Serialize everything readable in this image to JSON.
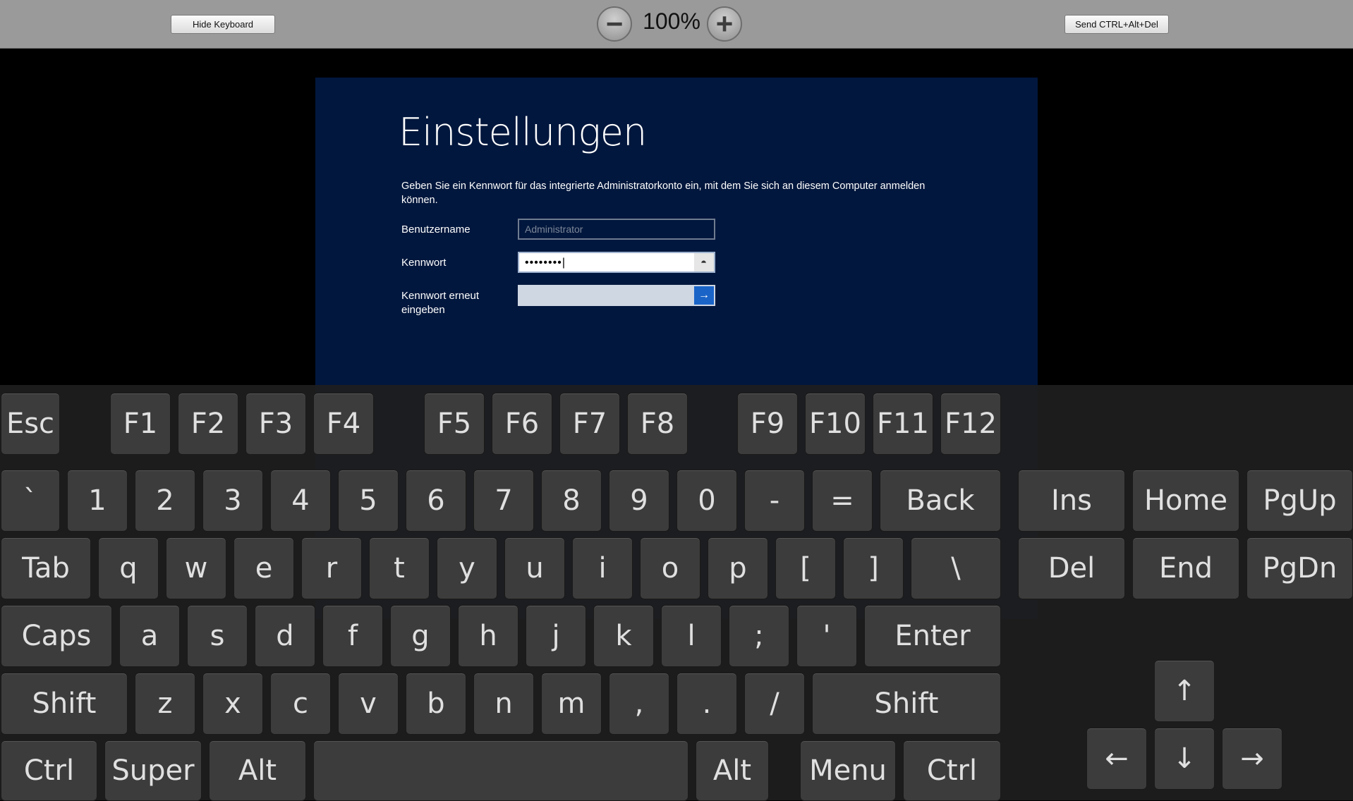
{
  "toolbar": {
    "hide_keyboard": "Hide Keyboard",
    "zoom": "100%",
    "zoom_out": "−",
    "zoom_in": "+",
    "send_cad": "Send CTRL+Alt+Del"
  },
  "remote": {
    "title": "Einstellungen",
    "description": "Geben Sie ein Kennwort für das integrierte Administratorkonto ein, mit dem Sie sich an diesem Computer anmelden können.",
    "username_label": "Benutzername",
    "username_placeholder": "Administrator",
    "password_label": "Kennwort",
    "password_value": "••••••••|",
    "password_confirm_label": "Kennwort erneut eingeben",
    "reveal_glyph": "◓",
    "go_glyph": "→"
  },
  "keyboard": {
    "fn": [
      "Esc",
      "F1",
      "F2",
      "F3",
      "F4",
      "F5",
      "F6",
      "F7",
      "F8",
      "F9",
      "F10",
      "F11",
      "F12"
    ],
    "row1": [
      "`",
      "1",
      "2",
      "3",
      "4",
      "5",
      "6",
      "7",
      "8",
      "9",
      "0",
      "-",
      "=",
      "Back"
    ],
    "row2": [
      "Tab",
      "q",
      "w",
      "e",
      "r",
      "t",
      "y",
      "u",
      "i",
      "o",
      "p",
      "[",
      "]",
      "\\"
    ],
    "row3": [
      "Caps",
      "a",
      "s",
      "d",
      "f",
      "g",
      "h",
      "j",
      "k",
      "l",
      ";",
      "'",
      "Enter"
    ],
    "row4": [
      "Shift",
      "z",
      "x",
      "c",
      "v",
      "b",
      "n",
      "m",
      ",",
      ".",
      "/",
      "Shift"
    ],
    "row5": [
      "Ctrl",
      "Super",
      "Alt",
      " ",
      "Alt",
      "Menu",
      "Ctrl"
    ],
    "nav": [
      "Ins",
      "Home",
      "PgUp",
      "Del",
      "End",
      "PgDn"
    ],
    "arrows": [
      "↑",
      "←",
      "↓",
      "→"
    ]
  },
  "colors": {
    "remote_bg": "#02173d",
    "go_button": "#1a64c8"
  }
}
